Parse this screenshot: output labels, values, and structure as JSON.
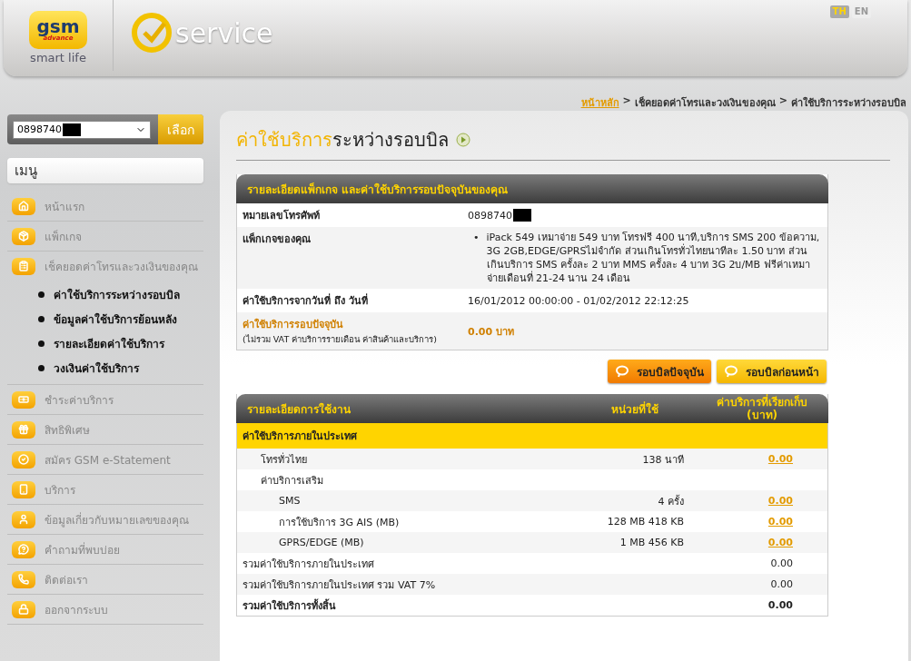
{
  "header": {
    "logo_mark": "gsm",
    "logo_sub": "advance",
    "tagline": "smart life",
    "product": "service"
  },
  "languages": [
    {
      "label": "TH",
      "selected": true
    },
    {
      "label": "EN",
      "selected": false
    }
  ],
  "number_select": {
    "value": "0898740",
    "redacted": true,
    "button": "เลือก"
  },
  "menu": {
    "title": "เมนู",
    "items": [
      {
        "label": "หน้าแรก"
      },
      {
        "label": "แพ็กเกจ"
      },
      {
        "label": "เช็คยอดค่าโทรและวงเงินของคุณ",
        "expanded": true,
        "children": [
          {
            "label": "ค่าใช้บริการระหว่างรอบบิล"
          },
          {
            "label": "ข้อมูลค่าใช้บริการย้อนหลัง"
          },
          {
            "label": "รายละเอียดค่าใช้บริการ"
          },
          {
            "label": "วงเงินค่าใช้บริการ"
          }
        ]
      },
      {
        "label": "ชำระค่าบริการ"
      },
      {
        "label": "สิทธิพิเศษ"
      },
      {
        "label": "สมัคร GSM e-Statement"
      },
      {
        "label": "บริการ"
      },
      {
        "label": "ข้อมูลเกี่ยวกับหมายเลขของคุณ"
      },
      {
        "label": "คำถามที่พบบ่อย"
      },
      {
        "label": "ติดต่อเรา"
      },
      {
        "label": "ออกจากระบบ"
      }
    ]
  },
  "breadcrumb": {
    "separator": ">",
    "items": [
      {
        "label": "หน้าหลัก",
        "kind": "link"
      },
      {
        "label": "เช็คยอดค่าโทรและวงเงินของคุณ",
        "kind": "text"
      },
      {
        "label": "ค่าใช้บริการระหว่างรอบบิล",
        "kind": "text"
      }
    ]
  },
  "page_title": {
    "highlight": "ค่าใช้บริการ",
    "rest": "ระหว่างรอบบิล"
  },
  "summary": {
    "title": "รายละเอียดแพ็กเกจ และค่าใช้บริการรอบปัจจุบันของคุณ",
    "rows": [
      {
        "kind": "text",
        "label": "หมายเลขโทรศัพท์",
        "value": "0898740",
        "redacted": true
      },
      {
        "kind": "bullets",
        "label": "แพ็กเกจของคุณ",
        "marker": "•",
        "bullets": [
          "iPack 549 เหมาจ่าย 549 บาท โทรฟรี 400 นาที,บริการ SMS 200 ข้อความ, 3G 2GB,EDGE/GPRSไม่จำกัด ส่วนเกินโทรทั่วไทยนาทีละ 1.50 บาท ส่วนเกินบริการ SMS ครั้งละ 2 บาท MMS ครั้งละ 4 บาท 3G 2บ/MB ฟรีค่าเหมาจ่ายเดือนที่ 21-24 นาน 24 เดือน"
        ]
      },
      {
        "kind": "text",
        "label": "ค่าใช้บริการจากวันที่ ถึง วันที่",
        "value": "16/01/2012 00:00:00 - 01/02/2012 22:12:25"
      },
      {
        "kind": "highlight",
        "label": "ค่าใช้บริการรอบปัจจุบัน",
        "note": "(ไม่รวม VAT ค่าบริการรายเดือน ค่าสินค้าและบริการ)",
        "value": "0.00 บาท"
      }
    ]
  },
  "bill_buttons": [
    {
      "label": "รอบบิลปัจจุบัน",
      "selected": true
    },
    {
      "label": "รอบบิลก่อนหน้า",
      "selected": false
    }
  ],
  "usage": {
    "columns": [
      "รายละเอียดการใช้งาน",
      "หน่วยที่ใช้",
      "ค่าบริการที่เรียกเก็บ (บาท)"
    ],
    "rows": [
      {
        "kind": "section",
        "label": "ค่าใช้บริการภายในประเทศ"
      },
      {
        "kind": "item",
        "label": "โทรทั่วไทย",
        "units": "138 นาที",
        "amount": "0.00"
      },
      {
        "kind": "group",
        "label": "ค่าบริการเสริม",
        "children": [
          {
            "kind": "item",
            "label": "SMS",
            "units": "4 ครั้ง",
            "amount": "0.00"
          },
          {
            "kind": "item",
            "label": "การใช้บริการ 3G AIS (MB)",
            "units": "128 MB 418 KB",
            "amount": "0.00"
          },
          {
            "kind": "item",
            "label": "GPRS/EDGE (MB)",
            "units": "1 MB 456 KB",
            "amount": "0.00"
          }
        ]
      },
      {
        "kind": "total",
        "label": "รวมค่าใช้บริการภายในประเทศ",
        "amount": "0.00"
      },
      {
        "kind": "total",
        "label": "รวมค่าใช้บริการภายในประเทศ รวม VAT 7%",
        "amount": "0.00"
      },
      {
        "kind": "grand_total",
        "label": "รวมค่าใช้บริการทั้งสิ้น",
        "amount": "0.00"
      }
    ]
  }
}
